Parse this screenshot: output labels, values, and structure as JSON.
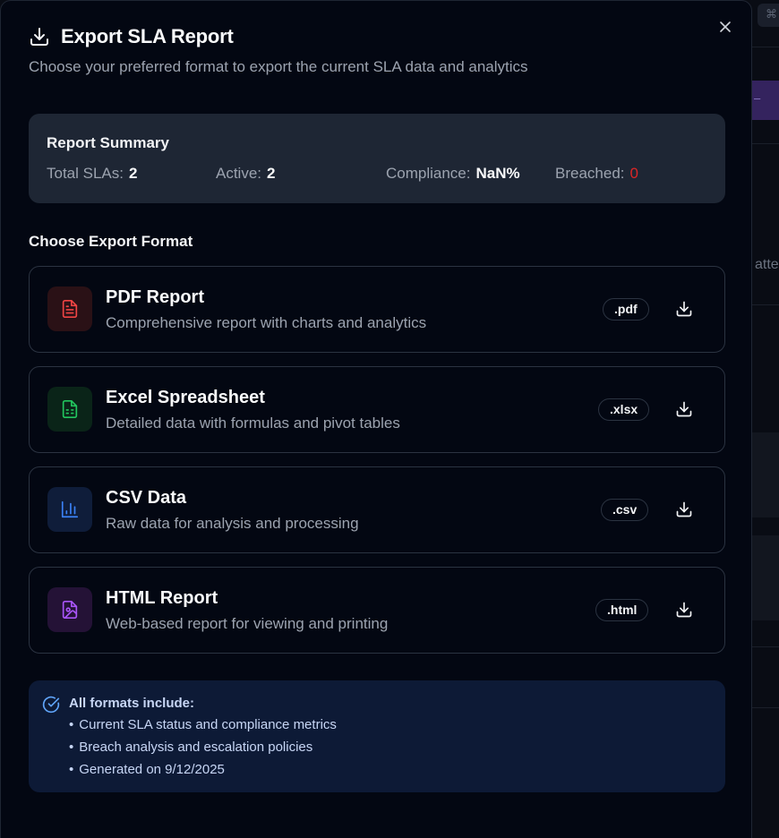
{
  "background": {
    "kbd_glyph": "⌘",
    "peek_text": "atte"
  },
  "modal": {
    "title": "Export SLA Report",
    "subtitle": "Choose your preferred format to export the current SLA data and analytics"
  },
  "summary": {
    "title": "Report Summary",
    "stats": [
      {
        "label": "Total SLAs:",
        "value": "2"
      },
      {
        "label": "Active:",
        "value": "2"
      },
      {
        "label": "Compliance:",
        "value": "NaN%"
      },
      {
        "label": "Breached:",
        "value": "0"
      }
    ],
    "breached_color": "#dc2626"
  },
  "formats_title": "Choose Export Format",
  "formats": [
    {
      "name": "PDF Report",
      "description": "Comprehensive report with charts and analytics",
      "ext": ".pdf",
      "icon": "pdf-file-icon",
      "color": "#ef4444",
      "bg": "#2a1116"
    },
    {
      "name": "Excel Spreadsheet",
      "description": "Detailed data with formulas and pivot tables",
      "ext": ".xlsx",
      "icon": "spreadsheet-file-icon",
      "color": "#22c55e",
      "bg": "#0a2418"
    },
    {
      "name": "CSV Data",
      "description": "Raw data for analysis and processing",
      "ext": ".csv",
      "icon": "bar-chart-icon",
      "color": "#3b82f6",
      "bg": "#0f1d3a"
    },
    {
      "name": "HTML Report",
      "description": "Web-based report for viewing and printing",
      "ext": ".html",
      "icon": "image-file-icon",
      "color": "#a855f7",
      "bg": "#241236"
    }
  ],
  "info": {
    "title": "All formats include:",
    "items": [
      "Current SLA status and compliance metrics",
      "Breach analysis and escalation policies",
      "Generated on 9/12/2025"
    ]
  }
}
